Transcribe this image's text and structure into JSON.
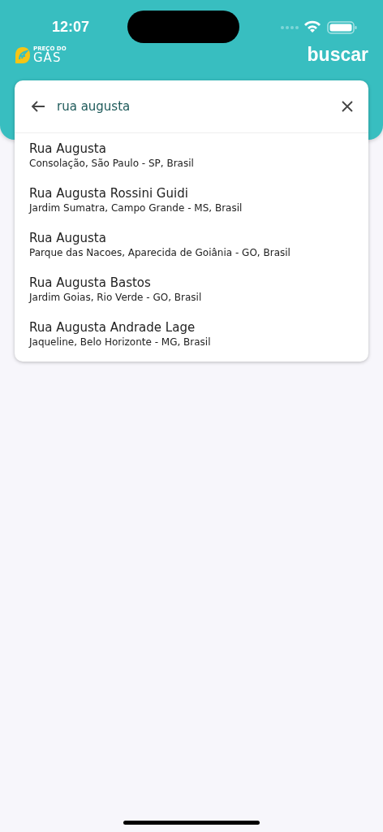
{
  "status_bar": {
    "time": "12:07"
  },
  "header": {
    "logo_top": "PREÇO DO",
    "logo_bottom": "GÁS",
    "action": "buscar"
  },
  "search": {
    "value": "rua augusta"
  },
  "results": [
    {
      "title": "Rua Augusta",
      "subtitle": "Consolação, São Paulo - SP, Brasil"
    },
    {
      "title": "Rua Augusta Rossini Guidi",
      "subtitle": "Jardim Sumatra, Campo Grande - MS, Brasil"
    },
    {
      "title": "Rua Augusta",
      "subtitle": "Parque das Nacoes, Aparecida de Goiânia - GO, Brasil"
    },
    {
      "title": "Rua Augusta Bastos",
      "subtitle": "Jardim Goias, Rio Verde - GO, Brasil"
    },
    {
      "title": "Rua Augusta Andrade Lage",
      "subtitle": "Jaqueline, Belo Horizonte - MG, Brasil"
    }
  ]
}
